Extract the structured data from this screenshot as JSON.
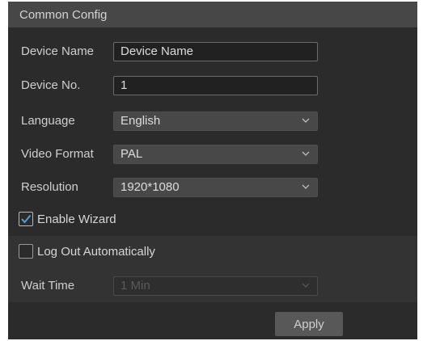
{
  "header": {
    "title": "Common Config"
  },
  "fields": {
    "device_name": {
      "label": "Device Name",
      "value": "Device Name"
    },
    "device_no": {
      "label": "Device No.",
      "value": "1"
    },
    "language": {
      "label": "Language",
      "value": "English"
    },
    "video_format": {
      "label": "Video Format",
      "value": "PAL"
    },
    "resolution": {
      "label": "Resolution",
      "value": "1920*1080"
    },
    "wait_time": {
      "label": "Wait Time",
      "value": "1 Min"
    }
  },
  "checkboxes": {
    "enable_wizard": {
      "label": "Enable Wizard",
      "checked": true
    },
    "log_out_auto": {
      "label": "Log Out Automatically",
      "checked": false
    }
  },
  "actions": {
    "apply_label": "Apply"
  },
  "colors": {
    "accent": "#4aa3e0",
    "panel": "#2b2b2b",
    "header": "#474747"
  }
}
